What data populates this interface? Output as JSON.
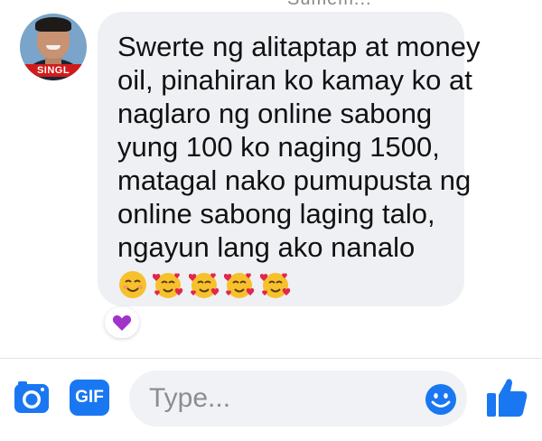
{
  "header": {
    "cut_off_name": "Sumem..."
  },
  "avatar": {
    "tag_text": "SINGL"
  },
  "message": {
    "lines": [
      "Swerte ng alitaptap at money",
      "oil, pinahiran ko kamay ko at",
      "naglaro ng online sabong",
      "yung 100 ko naging 1500,",
      "matagal nako pumupusta ng",
      "online sabong laging talo,",
      "ngayun lang ako nanalo"
    ],
    "emojis": [
      "smiling-face-icon",
      "smiling-face-with-hearts-icon",
      "smiling-face-with-hearts-icon",
      "smiling-face-with-hearts-icon",
      "smiling-face-with-hearts-icon"
    ]
  },
  "reaction": {
    "icon": "purple-heart-icon",
    "color": "#a033c8"
  },
  "composer": {
    "gif_label": "GIF",
    "placeholder": "Type...",
    "accent_color": "#1a77f2"
  }
}
